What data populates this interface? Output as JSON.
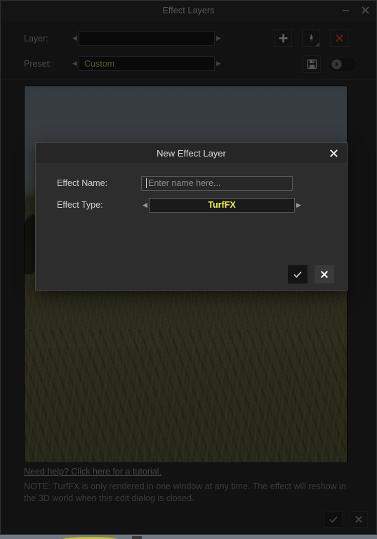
{
  "window": {
    "title": "Effect Layers",
    "minimize_icon": "minimize-icon",
    "close_icon": "close-icon"
  },
  "form": {
    "layer": {
      "label": "Layer:",
      "value": "",
      "prev_arrow": "◀",
      "next_arrow": "▶"
    },
    "preset": {
      "label": "Preset:",
      "value": "Custom",
      "prev_arrow": "◀",
      "next_arrow": "▶"
    },
    "buttons": {
      "add": "add-layer-icon",
      "paint": "paint-layer-icon",
      "delete": "delete-layer-icon",
      "save": "save-preset-icon",
      "apply": "apply-preset-icon"
    }
  },
  "preview": {
    "alt": "3D world turf preview"
  },
  "footer": {
    "tutorial_link": "Need help? Click here for a tutorial.",
    "note": "NOTE: TurfFX is only rendered in one window at any time. The effect will reshow in the 3D world when this edit dialog is closed.",
    "accept_icon": "check-icon",
    "cancel_icon": "cross-icon"
  },
  "dialog": {
    "title": "New Effect Layer",
    "close_icon": "close-icon",
    "effect_name": {
      "label": "Effect Name:",
      "value": "",
      "placeholder": "Enter name here..."
    },
    "effect_type": {
      "label": "Effect Type:",
      "value": "TurfFX",
      "prev_arrow": "◀",
      "next_arrow": "▶"
    },
    "accept_icon": "check-icon",
    "cancel_icon": "cross-icon"
  },
  "colors": {
    "window_bg": "#1e1e1e",
    "dialog_bg": "#2d2d2d",
    "accent_yellow": "#f2f24d",
    "preset_yellow": "#b5b555",
    "delete_red": "#b03232"
  }
}
